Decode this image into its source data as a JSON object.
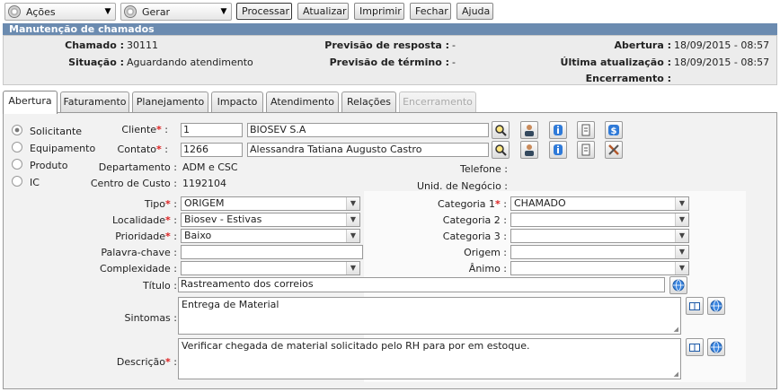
{
  "toolbar": {
    "acoes": "Ações",
    "gerar": "Gerar",
    "processar": "Processar",
    "atualizar": "Atualizar",
    "imprimir": "Imprimir",
    "fechar": "Fechar",
    "ajuda": "Ajuda"
  },
  "header": {
    "title": "Manutenção de chamados",
    "chamado_label": "Chamado :",
    "chamado_value": "30111",
    "previsao_resposta_label": "Previsão de resposta :",
    "previsao_resposta_value": "-",
    "abertura_label": "Abertura :",
    "abertura_value": "18/09/2015 - 08:57",
    "situacao_label": "Situação :",
    "situacao_value": "Aguardando atendimento",
    "previsao_termino_label": "Previsão de término :",
    "previsao_termino_value": "-",
    "ultima_atualizacao_label": "Última atualização :",
    "ultima_atualizacao_value": "18/09/2015 - 08:57",
    "encerramento_label": "Encerramento :",
    "encerramento_value": ""
  },
  "tabs": [
    "Abertura",
    "Faturamento",
    "Planejamento",
    "Impacto",
    "Atendimento",
    "Relações",
    "Encerramento"
  ],
  "radios": [
    "Solicitante",
    "Equipamento",
    "Produto",
    "IC"
  ],
  "form": {
    "cliente_label": "Cliente",
    "cliente_code": "1",
    "cliente_name": "BIOSEV S.A",
    "contato_label": "Contato",
    "contato_code": "1266",
    "contato_name": "Alessandra Tatiana Augusto Castro",
    "departamento_label": "Departamento :",
    "departamento_value": "ADM e CSC",
    "centro_custo_label": "Centro de Custo :",
    "centro_custo_value": "1192104",
    "telefone_label": "Telefone :",
    "unid_negocio_label": "Unid. de Negócio :",
    "tipo_label": "Tipo",
    "tipo_value": "ORIGEM",
    "localidade_label": "Localidade",
    "localidade_value": "Biosev - Estivas",
    "prioridade_label": "Prioridade",
    "prioridade_value": "Baixo",
    "palavra_chave_label": "Palavra-chave :",
    "palavra_chave_value": "",
    "complexidade_label": "Complexidade :",
    "complexidade_value": "",
    "categoria1_label": "Categoria 1",
    "categoria1_value": "CHAMADO",
    "categoria2_label": "Categoria 2 :",
    "categoria2_value": "",
    "categoria3_label": "Categoria 3 :",
    "categoria3_value": "",
    "origem_label": "Origem :",
    "origem_value": "",
    "animo_label": "Ânimo :",
    "animo_value": "",
    "titulo_label": "Título :",
    "titulo_value": "Rastreamento dos correios",
    "sintomas_label": "Sintomas :",
    "sintomas_value": "Entrega de Material",
    "descricao_label": "Descrição",
    "descricao_value": "Verificar chegada de material solicitado pelo RH para por em estoque."
  },
  "colors": {
    "header_bar": "#6b8bb0",
    "required": "#d22222",
    "panel": "#ececec"
  }
}
